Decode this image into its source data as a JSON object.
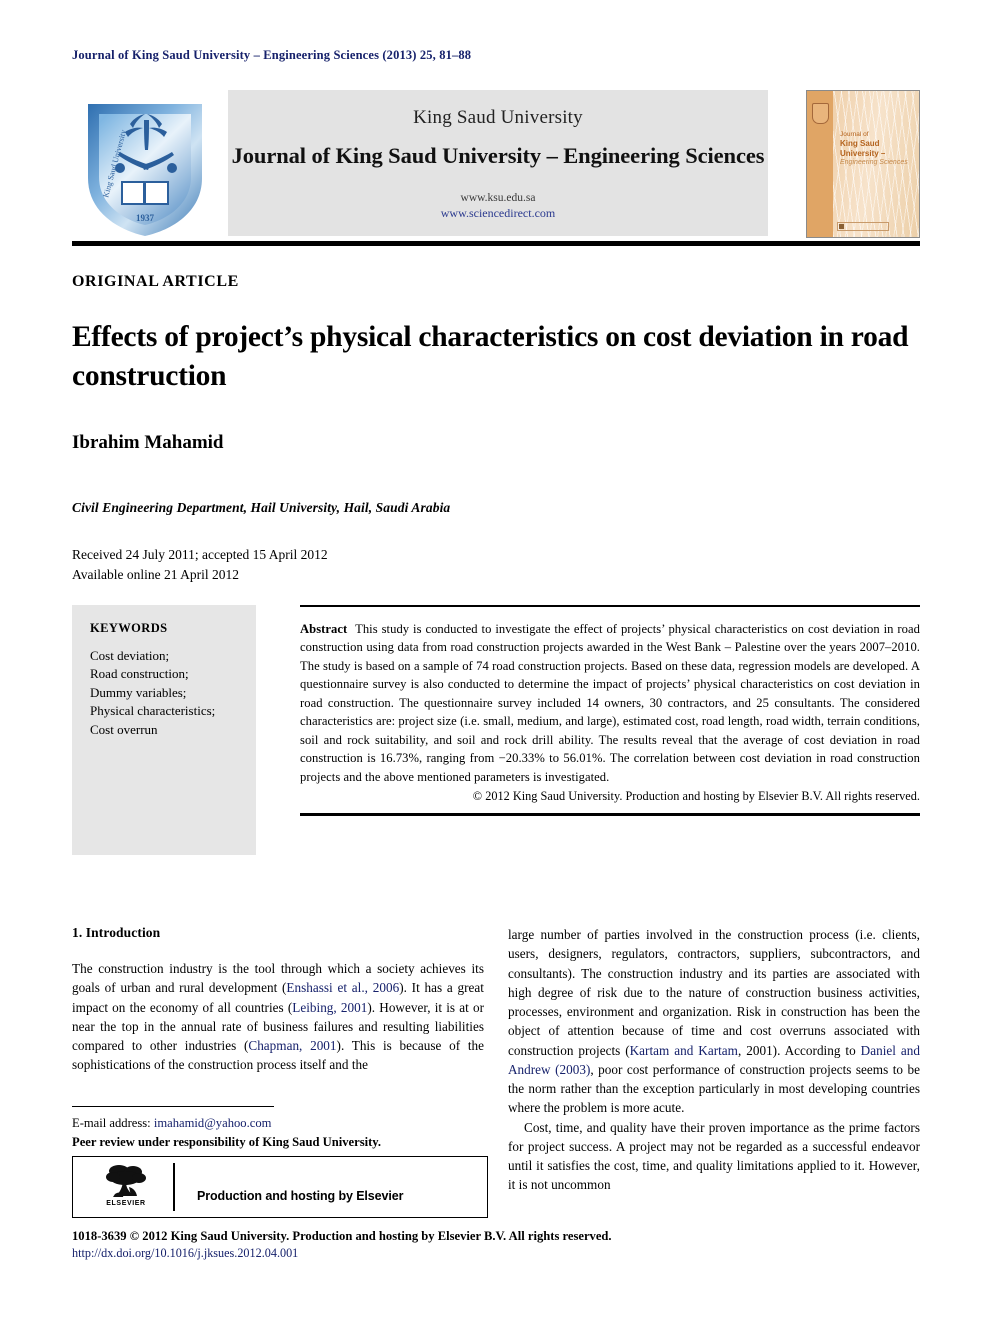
{
  "running_head": "Journal of King Saud University – Engineering Sciences (2013) 25, 81–88",
  "masthead": {
    "logo_alt": "King Saud University shield 1937",
    "university": "King Saud University",
    "journal_title": "Journal of King Saud University – Engineering Sciences",
    "url_ksu": "www.ksu.edu.sa",
    "url_sciencedirect": "www.sciencedirect.com",
    "cover": {
      "line1": "Journal of",
      "line2": "King Saud University –",
      "line3": "Engineering Sciences"
    }
  },
  "article": {
    "type_label": "ORIGINAL ARTICLE",
    "title": "Effects of project’s physical characteristics on cost deviation in road construction",
    "author": "Ibrahim Mahamid",
    "affiliation": "Civil Engineering Department, Hail University, Hail, Saudi Arabia",
    "received": "Received 24 July 2011; accepted 15 April 2012",
    "available_online": "Available online 21 April 2012"
  },
  "keywords": {
    "heading": "KEYWORDS",
    "items": [
      "Cost deviation;",
      "Road construction;",
      "Dummy variables;",
      "Physical characteristics;",
      "Cost overrun"
    ]
  },
  "abstract": {
    "label": "Abstract",
    "text": "This study is conducted to investigate the effect of projects’ physical characteristics on cost deviation in road construction using data from road construction projects awarded in the West Bank – Palestine over the years 2007–2010. The study is based on a sample of 74 road construction projects. Based on these data, regression models are developed. A questionnaire survey is also conducted to determine the impact of projects’ physical characteristics on cost deviation in road construction. The questionnaire survey included 14 owners, 30 contractors, and 25 consultants. The considered characteristics are: project size (i.e. small, medium, and large), estimated cost, road length, road width, terrain conditions, soil and rock suitability, and soil and rock drill ability. The results reveal that the average of cost deviation in road construction is 16.73%, ranging from −20.33% to 56.01%. The correlation between cost deviation in road construction projects and the above mentioned parameters is investigated.",
    "copyright": "© 2012 King Saud University. Production and hosting by Elsevier B.V. All rights reserved."
  },
  "body": {
    "section_heading": "1. Introduction",
    "left_paragraph_parts": {
      "p1_a": "The construction industry is the tool through which a society achieves its goals of urban and rural development (",
      "p1_ref1": "Enshassi et al., 2006",
      "p1_b": "). It has a great impact on the economy of all countries (",
      "p1_ref2": "Leibing, 2001",
      "p1_c": "). However, it is at or near the top in the annual rate of business failures and resulting liabilities compared to other industries (",
      "p1_ref3": "Chapman, 2001",
      "p1_d": "). This is because of the sophistications of the construction process itself and the"
    },
    "right_paragraph_parts": {
      "p2_a": "large number of parties involved in the construction process (i.e. clients, users, designers, regulators, contractors, suppliers, subcontractors, and consultants). The construction industry and its parties are associated with high degree of risk due to the nature of construction business activities, processes, environment and organization. Risk in construction has been the object of attention because of time and cost overruns associated with construction projects (",
      "p2_ref1": "Kartam and Kartam",
      "p2_b": ", 2001). According to ",
      "p2_ref2": "Daniel and Andrew (2003)",
      "p2_c": ", poor cost performance of construction projects seems to be the norm rather than the exception particularly in most developing countries where the problem is more acute.",
      "p3": "Cost, time, and quality have their proven importance as the prime factors for project success. A project may not be regarded as a successful endeavor until it satisfies the cost, time, and quality limitations applied to it. However, it is not uncommon"
    }
  },
  "footnote": {
    "email_label": "E-mail address:",
    "email": "imahamid@yahoo.com",
    "peer_review": "Peer review under responsibility of King Saud University.",
    "elsevier_word": "ELSEVIER",
    "production_hosting": "Production and hosting by Elsevier"
  },
  "page_footer": {
    "issn_line": "1018-3639 © 2012 King Saud University. Production and hosting by Elsevier B.V. All rights reserved.",
    "doi": "http://dx.doi.org/10.1016/j.jksues.2012.04.001"
  },
  "colors": {
    "link": "#16216b",
    "masthead_bg": "#e3e3e3",
    "keywords_bg": "#e6e6e6",
    "cover_orange": "#e0a565"
  }
}
